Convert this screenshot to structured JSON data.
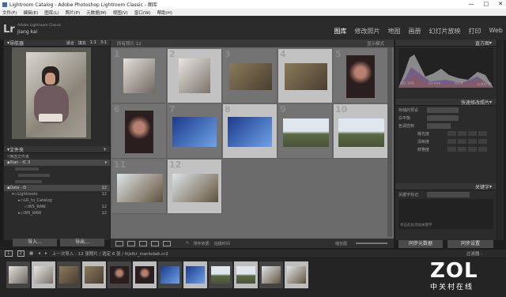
{
  "window": {
    "title": "Lightroom Catalog - Adobe Photoshop Lightroom Classic - 图库",
    "min": "—",
    "max": "□",
    "close": "✕"
  },
  "menu": [
    "文件(F)",
    "编辑(E)",
    "图库(L)",
    "照片(P)",
    "元数据(M)",
    "视图(V)",
    "窗口(W)",
    "帮助(H)"
  ],
  "identity": {
    "logo": "Lr",
    "sub": "Adobe Lightroom Classic",
    "user": "jiang kai"
  },
  "modules": [
    "图库",
    "修改照片",
    "地图",
    "画册",
    "幻灯片放映",
    "打印",
    "Web"
  ],
  "left": {
    "navigator": "导航器",
    "fit": "适合",
    "zoom_levels": [
      "填充",
      "1:1",
      "3:1"
    ],
    "folders_title": "文件夹",
    "filter": "筛选文件夹",
    "volumes": [
      {
        "name": "Xian - IC 3",
        "count": ""
      },
      {
        "name": "Data - D",
        "count": "12"
      }
    ],
    "tree": [
      {
        "label": "Lightroom",
        "count": "12"
      },
      {
        "label": "LR_to_Catalog",
        "count": ""
      },
      {
        "label": "WS_RAW",
        "count": "12"
      },
      {
        "label": "WS_RAW",
        "count": "12"
      }
    ],
    "import": "导入...",
    "export": "导出..."
  },
  "grid": {
    "header": "所有照片  12",
    "title_right": "显示模式",
    "cells": [
      "1",
      "2",
      "3",
      "4",
      "5",
      "6",
      "7",
      "8",
      "9",
      "10",
      "11",
      "12"
    ]
  },
  "toolbar": {
    "sort_label": "排序依据:",
    "sort_value": "拍摄时间",
    "thumbs": "缩览图"
  },
  "right": {
    "histogram": "直方图",
    "hist_info": [
      "ISO 100",
      "23 mm",
      "f/5.6",
      "1/400 秒"
    ],
    "quickdev": "快速修改照片",
    "rows": [
      "存储的预设",
      "白平衡",
      "色调控制",
      "曝光度",
      "清晰度",
      "鲜艳度"
    ],
    "preset_value": "默认设置",
    "wb_value": "原照设置",
    "keywords": "关键字",
    "kw_label": "关键字标记",
    "kw_value": "输入关键字",
    "kw_sugg": "单击此处添加关键字",
    "sync_meta": "同步元数据",
    "sync_settings": "同步设置"
  },
  "filmstrip": {
    "info": "上一次导入 : 12 张照片 / 选定 6 张 / ttjslkr_marlodak.cr2",
    "filter": "过滤器 :"
  },
  "watermark": {
    "big": "ZOL",
    "small": "中关村在线"
  },
  "colors": {
    "accent": "#4a4a4a",
    "selected_cell": "#c2c2c2",
    "app_bg": "#1e1e1e"
  }
}
